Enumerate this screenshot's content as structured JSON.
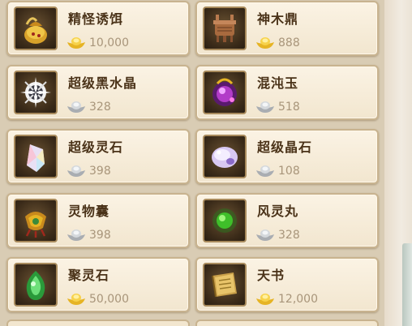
{
  "colors": {
    "gold_ingot": "#e6b424",
    "silver_ingot": "#c4c8cc",
    "card_bg": "#f6ecd9",
    "name_text": "#4a3218"
  },
  "items": [
    {
      "name": "精怪诱饵",
      "price": "10,000",
      "currency": "gold",
      "icon": "bait-pouch-icon"
    },
    {
      "name": "神木鼎",
      "price": "888",
      "currency": "gold",
      "icon": "bronze-cauldron-icon"
    },
    {
      "name": "超级黑水晶",
      "price": "328",
      "currency": "silver",
      "icon": "black-crystal-icon"
    },
    {
      "name": "混沌玉",
      "price": "518",
      "currency": "silver",
      "icon": "chaos-jade-icon"
    },
    {
      "name": "超级灵石",
      "price": "398",
      "currency": "silver",
      "icon": "spirit-stone-icon"
    },
    {
      "name": "超级晶石",
      "price": "108",
      "currency": "silver",
      "icon": "crystal-stone-icon"
    },
    {
      "name": "灵物囊",
      "price": "398",
      "currency": "silver",
      "icon": "spirit-bag-icon"
    },
    {
      "name": "风灵丸",
      "price": "328",
      "currency": "silver",
      "icon": "wind-pill-icon"
    },
    {
      "name": "聚灵石",
      "price": "50,000",
      "currency": "gold",
      "icon": "gathering-stone-icon"
    },
    {
      "name": "天书",
      "price": "12,000",
      "currency": "gold",
      "icon": "heavenly-book-icon"
    }
  ]
}
